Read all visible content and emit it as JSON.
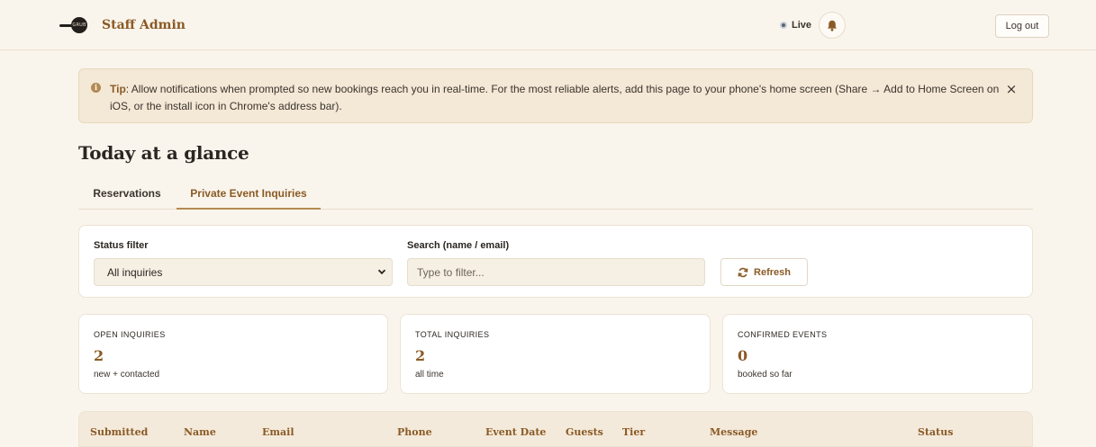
{
  "header": {
    "logo_text": "GRUB",
    "title": "Staff Admin",
    "live_label": "Live",
    "logout_label": "Log out"
  },
  "tip": {
    "label": "Tip",
    "message": ": Allow notifications when prompted so new bookings reach you in real-time. For the most reliable alerts, add this page to your phone's home screen (Share → Add to Home Screen on iOS, or the install icon in Chrome's address bar).",
    "close_symbol": "×"
  },
  "page": {
    "title": "Today at a glance"
  },
  "tabs": [
    {
      "label": "Reservations",
      "active": false
    },
    {
      "label": "Private Event Inquiries",
      "active": true
    }
  ],
  "filters": {
    "status_label": "Status filter",
    "status_value": "All inquiries",
    "search_label": "Search (name / email)",
    "search_placeholder": "Type to filter...",
    "refresh_label": "Refresh"
  },
  "stats": [
    {
      "label": "OPEN INQUIRIES",
      "value": "2",
      "note": "new + contacted"
    },
    {
      "label": "TOTAL INQUIRIES",
      "value": "2",
      "note": "all time"
    },
    {
      "label": "CONFIRMED EVENTS",
      "value": "0",
      "note": "booked so far"
    }
  ],
  "table": {
    "columns": [
      "Submitted",
      "Name",
      "Email",
      "Phone",
      "Event Date",
      "Guests",
      "Tier",
      "Message",
      "Status"
    ]
  },
  "colors": {
    "accent": "#8a5a25",
    "background": "#faf5ec",
    "tip_background": "#f4e8d6"
  }
}
